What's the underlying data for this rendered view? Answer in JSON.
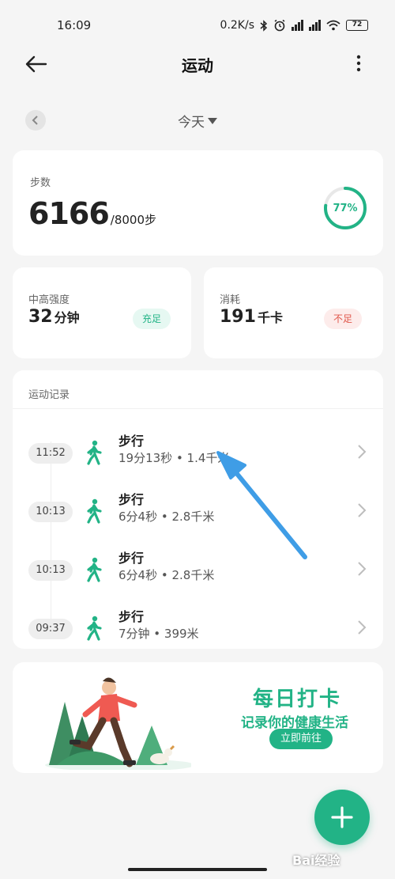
{
  "status_bar": {
    "time": "16:09",
    "net_speed": "0.2K/s",
    "battery": "72"
  },
  "app_bar": {
    "title": "运动"
  },
  "date_selector": {
    "label": "今天"
  },
  "steps": {
    "label": "步数",
    "value": "6166",
    "goal": "/8000步",
    "percent_text": "77%",
    "progress_fraction": 0.77
  },
  "intensity": {
    "label": "中高强度",
    "value": "32",
    "unit": "分钟",
    "badge": "充足"
  },
  "calories": {
    "label": "消耗",
    "value": "191",
    "unit": "千卡",
    "badge": "不足"
  },
  "records": {
    "title": "运动记录",
    "items": [
      {
        "time": "11:52",
        "name": "步行",
        "detail": "19分13秒 • 1.4千米"
      },
      {
        "time": "10:13",
        "name": "步行",
        "detail": "6分4秒 • 2.8千米"
      },
      {
        "time": "10:13",
        "name": "步行",
        "detail": "6分4秒 • 2.8千米"
      },
      {
        "time": "09:37",
        "name": "步行",
        "detail": "7分钟 • 399米"
      }
    ]
  },
  "banner": {
    "title": "每日打卡",
    "subtitle": "记录你的健康生活",
    "button": "立即前往"
  },
  "watermark": "Bai经验",
  "colors": {
    "accent": "#22b386",
    "warning": "#e0574b",
    "arrow": "#3f9de6"
  },
  "icons": {
    "back": "arrow-left-icon",
    "more": "more-vertical-icon",
    "prev": "chevron-left-icon",
    "walk": "walking-person-icon",
    "chevron": "chevron-right-icon",
    "add": "plus-icon"
  }
}
